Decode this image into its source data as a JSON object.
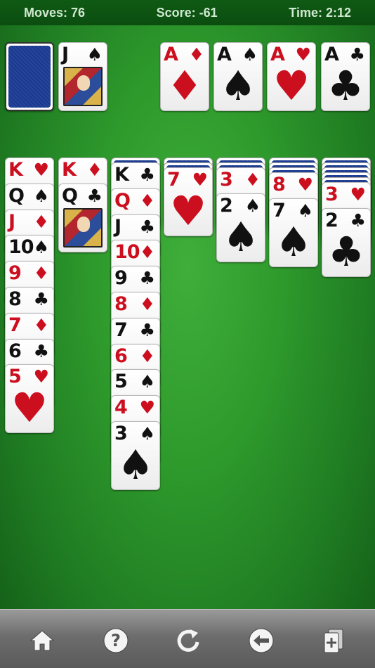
{
  "status": {
    "moves": "Moves: 76",
    "score": "Score: -61",
    "time": "Time: 2:12"
  },
  "stock": {
    "state": "face-down"
  },
  "waste": {
    "rank": "J",
    "suit": "♠",
    "color": "black"
  },
  "foundations": [
    {
      "rank": "A",
      "suit": "♦",
      "color": "red"
    },
    {
      "rank": "A",
      "suit": "♠",
      "color": "black"
    },
    {
      "rank": "A",
      "suit": "♥",
      "color": "red"
    },
    {
      "rank": "A",
      "suit": "♣",
      "color": "black"
    }
  ],
  "tableau": [
    {
      "hidden": 0,
      "cards": [
        {
          "rank": "K",
          "suit": "♥",
          "color": "red"
        },
        {
          "rank": "Q",
          "suit": "♠",
          "color": "black"
        },
        {
          "rank": "J",
          "suit": "♦",
          "color": "red"
        },
        {
          "rank": "10",
          "suit": "♠",
          "color": "black"
        },
        {
          "rank": "9",
          "suit": "♦",
          "color": "red"
        },
        {
          "rank": "8",
          "suit": "♣",
          "color": "black"
        },
        {
          "rank": "7",
          "suit": "♦",
          "color": "red"
        },
        {
          "rank": "6",
          "suit": "♣",
          "color": "black"
        },
        {
          "rank": "5",
          "suit": "♥",
          "color": "red"
        }
      ]
    },
    {
      "hidden": 0,
      "cards": [
        {
          "rank": "K",
          "suit": "♦",
          "color": "red"
        },
        {
          "rank": "Q",
          "suit": "♣",
          "color": "black"
        }
      ]
    },
    {
      "hidden": 1,
      "cards": [
        {
          "rank": "K",
          "suit": "♣",
          "color": "black"
        },
        {
          "rank": "Q",
          "suit": "♦",
          "color": "red"
        },
        {
          "rank": "J",
          "suit": "♣",
          "color": "black"
        },
        {
          "rank": "10",
          "suit": "♦",
          "color": "red"
        },
        {
          "rank": "9",
          "suit": "♣",
          "color": "black"
        },
        {
          "rank": "8",
          "suit": "♦",
          "color": "red"
        },
        {
          "rank": "7",
          "suit": "♣",
          "color": "black"
        },
        {
          "rank": "6",
          "suit": "♦",
          "color": "red"
        },
        {
          "rank": "5",
          "suit": "♠",
          "color": "black"
        },
        {
          "rank": "4",
          "suit": "♥",
          "color": "red"
        },
        {
          "rank": "3",
          "suit": "♠",
          "color": "black"
        }
      ]
    },
    {
      "hidden": 2,
      "cards": [
        {
          "rank": "7",
          "suit": "♥",
          "color": "red"
        }
      ]
    },
    {
      "hidden": 2,
      "cards": [
        {
          "rank": "3",
          "suit": "♦",
          "color": "red"
        },
        {
          "rank": "2",
          "suit": "♠",
          "color": "black"
        }
      ]
    },
    {
      "hidden": 3,
      "cards": [
        {
          "rank": "8",
          "suit": "♥",
          "color": "red"
        },
        {
          "rank": "7",
          "suit": "♠",
          "color": "black"
        }
      ]
    },
    {
      "hidden": 5,
      "cards": [
        {
          "rank": "3",
          "suit": "♥",
          "color": "red"
        },
        {
          "rank": "2",
          "suit": "♣",
          "color": "black"
        }
      ]
    }
  ],
  "toolbar": [
    {
      "name": "home-button",
      "icon": "home-icon"
    },
    {
      "name": "help-button",
      "icon": "question-icon"
    },
    {
      "name": "restart-button",
      "icon": "restart-icon"
    },
    {
      "name": "undo-button",
      "icon": "undo-icon"
    },
    {
      "name": "new-game-button",
      "icon": "new-deal-icon"
    }
  ]
}
